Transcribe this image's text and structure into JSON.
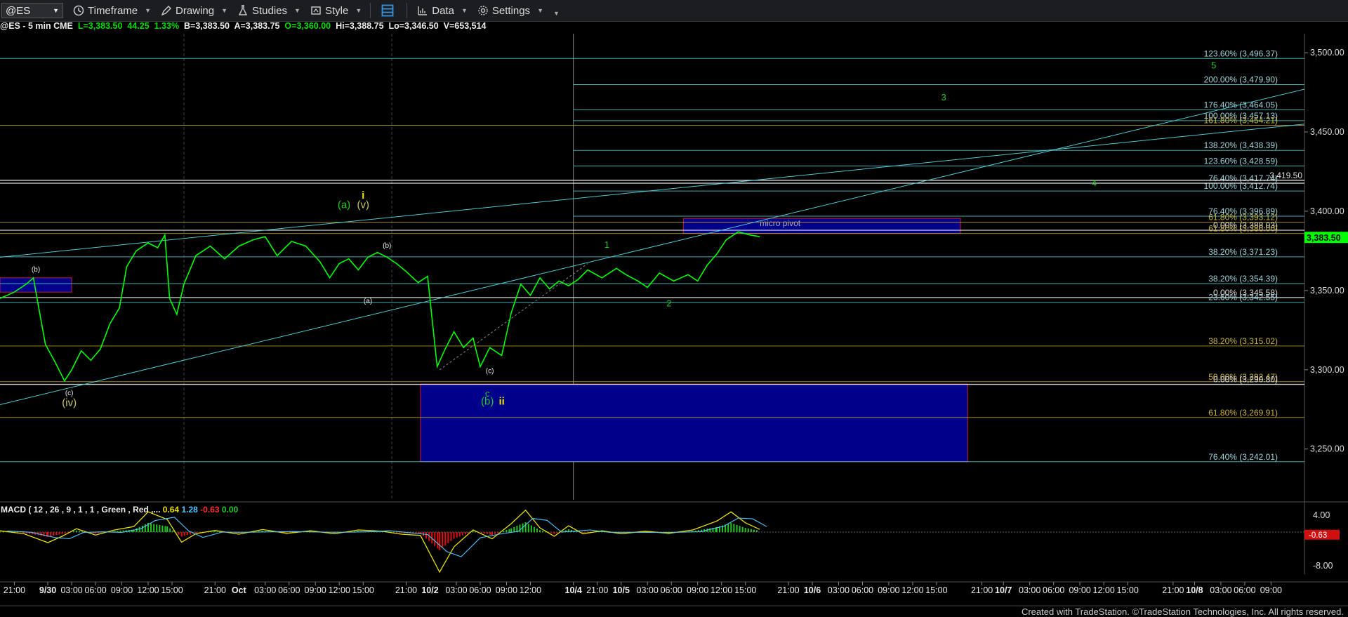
{
  "toolbar": {
    "symbol": "@ES",
    "items": [
      {
        "label": "Timeframe",
        "icon": "clock-icon"
      },
      {
        "label": "Drawing",
        "icon": "pencil-icon"
      },
      {
        "label": "Studies",
        "icon": "flask-icon"
      },
      {
        "label": "Style",
        "icon": "style-icon"
      },
      {
        "label": "",
        "icon": "layout-icon"
      },
      {
        "label": "Data",
        "icon": "data-icon"
      },
      {
        "label": "Settings",
        "icon": "gear-icon"
      }
    ]
  },
  "status": {
    "prefix": "@ES - 5 min  CME",
    "L": "L=3,383.50",
    "chg": "44.25",
    "pct": "1.33%",
    "B": "B=3,383.50",
    "A": "A=3,383.75",
    "O": "O=3,360.00",
    "Hi": "Hi=3,388.75",
    "Lo": "Lo=3,346.50",
    "V": "V=653,514"
  },
  "footer": "Created with TradeStation. ©TradeStation Technologies, Inc. All rights reserved.",
  "colors": {
    "price": "#00ff00",
    "cyan": "#4fc8d0",
    "gold": "#b39b2a",
    "box": "#00008b",
    "boxBorder": "#c81e3c",
    "label": "#c8c864"
  },
  "chart_data": [
    {
      "type": "line",
      "title": "@ES - 5 min",
      "price_axis": {
        "ylim": [
          3218,
          3512
        ],
        "ticks": [
          3250,
          3300,
          3350,
          3400,
          3450,
          3500
        ],
        "tick_labels": [
          "3,250.00",
          "3,300.00",
          "3,350.00",
          "3,400.00",
          "3,450.00",
          "3,500.00"
        ]
      },
      "current_price": {
        "value": 3383.5,
        "label": "3,383.50"
      },
      "time_axis_labels": [
        {
          "t": 0.3,
          "label": "21:00"
        },
        {
          "t": 1.0,
          "label": "9/30"
        },
        {
          "t": 1.5,
          "label": "03:00"
        },
        {
          "t": 2.0,
          "label": "06:00"
        },
        {
          "t": 2.55,
          "label": "09:00"
        },
        {
          "t": 3.1,
          "label": "12:00"
        },
        {
          "t": 3.6,
          "label": "15:00"
        },
        {
          "t": 4.5,
          "label": "21:00"
        },
        {
          "t": 5.0,
          "label": "Oct"
        },
        {
          "t": 5.55,
          "label": "03:00"
        },
        {
          "t": 6.05,
          "label": "06:00"
        },
        {
          "t": 6.6,
          "label": "09:00"
        },
        {
          "t": 7.1,
          "label": "12:00"
        },
        {
          "t": 7.6,
          "label": "15:00"
        },
        {
          "t": 8.5,
          "label": "21:00"
        },
        {
          "t": 9.0,
          "label": "10/2"
        },
        {
          "t": 9.55,
          "label": "03:00"
        },
        {
          "t": 10.05,
          "label": "06:00"
        },
        {
          "t": 10.6,
          "label": "09:00"
        },
        {
          "t": 11.1,
          "label": "12:00"
        },
        {
          "t": 12.0,
          "label": "10/4"
        },
        {
          "t": 12.5,
          "label": "21:00"
        },
        {
          "t": 13.0,
          "label": "10/5"
        },
        {
          "t": 13.55,
          "label": "03:00"
        },
        {
          "t": 14.05,
          "label": "06:00"
        },
        {
          "t": 14.6,
          "label": "09:00"
        },
        {
          "t": 15.1,
          "label": "12:00"
        },
        {
          "t": 15.6,
          "label": "15:00"
        },
        {
          "t": 16.5,
          "label": "21:00"
        },
        {
          "t": 17.0,
          "label": "10/6"
        },
        {
          "t": 17.55,
          "label": "03:00"
        },
        {
          "t": 18.05,
          "label": "06:00"
        },
        {
          "t": 18.6,
          "label": "09:00"
        },
        {
          "t": 19.1,
          "label": "12:00"
        },
        {
          "t": 19.6,
          "label": "15:00"
        },
        {
          "t": 20.55,
          "label": "21:00"
        },
        {
          "t": 21.0,
          "label": "10/7"
        },
        {
          "t": 21.55,
          "label": "03:00"
        },
        {
          "t": 22.05,
          "label": "06:00"
        },
        {
          "t": 22.6,
          "label": "09:00"
        },
        {
          "t": 23.1,
          "label": "12:00"
        },
        {
          "t": 23.6,
          "label": "15:00"
        },
        {
          "t": 24.55,
          "label": "21:00"
        },
        {
          "t": 25.0,
          "label": "10/8"
        },
        {
          "t": 25.55,
          "label": "03:00"
        },
        {
          "t": 26.05,
          "label": "06:00"
        },
        {
          "t": 26.6,
          "label": "09:00"
        }
      ],
      "x_range": [
        0,
        27.3
      ],
      "series": [
        {
          "name": "price",
          "points": [
            [
              0,
              3345
            ],
            [
              0.3,
              3349
            ],
            [
              0.55,
              3354
            ],
            [
              0.7,
              3358
            ],
            [
              0.8,
              3341
            ],
            [
              0.95,
              3316
            ],
            [
              1.15,
              3305
            ],
            [
              1.35,
              3293
            ],
            [
              1.5,
              3300
            ],
            [
              1.7,
              3312
            ],
            [
              1.9,
              3306
            ],
            [
              2.1,
              3313
            ],
            [
              2.3,
              3329
            ],
            [
              2.5,
              3339
            ],
            [
              2.65,
              3365
            ],
            [
              2.85,
              3375
            ],
            [
              3.1,
              3380
            ],
            [
              3.3,
              3377
            ],
            [
              3.45,
              3385
            ],
            [
              3.55,
              3345
            ],
            [
              3.7,
              3335
            ],
            [
              3.85,
              3354
            ],
            [
              4.1,
              3372
            ],
            [
              4.4,
              3378
            ],
            [
              4.7,
              3370
            ],
            [
              5.0,
              3378
            ],
            [
              5.3,
              3382
            ],
            [
              5.55,
              3384
            ],
            [
              5.8,
              3372
            ],
            [
              6.1,
              3381
            ],
            [
              6.4,
              3378
            ],
            [
              6.7,
              3368
            ],
            [
              6.9,
              3358
            ],
            [
              7.1,
              3367
            ],
            [
              7.3,
              3370
            ],
            [
              7.5,
              3363
            ],
            [
              7.7,
              3371
            ],
            [
              7.9,
              3374
            ],
            [
              8.1,
              3371
            ],
            [
              8.3,
              3367
            ],
            [
              8.5,
              3362
            ],
            [
              8.75,
              3355
            ],
            [
              8.95,
              3359
            ],
            [
              9.05,
              3330
            ],
            [
              9.15,
              3302
            ],
            [
              9.3,
              3312
            ],
            [
              9.5,
              3324
            ],
            [
              9.7,
              3314
            ],
            [
              9.9,
              3320
            ],
            [
              10.05,
              3302
            ],
            [
              10.25,
              3314
            ],
            [
              10.5,
              3309
            ],
            [
              10.7,
              3336
            ],
            [
              10.9,
              3354
            ],
            [
              11.1,
              3347
            ],
            [
              11.3,
              3358
            ],
            [
              11.5,
              3351
            ],
            [
              11.7,
              3356
            ],
            [
              11.9,
              3353
            ],
            [
              12.1,
              3357
            ],
            [
              12.3,
              3363
            ],
            [
              12.6,
              3358
            ],
            [
              12.9,
              3364
            ],
            [
              13.1,
              3360
            ],
            [
              13.35,
              3356
            ],
            [
              13.55,
              3352
            ],
            [
              13.8,
              3361
            ],
            [
              14.1,
              3356
            ],
            [
              14.4,
              3360
            ],
            [
              14.6,
              3356
            ],
            [
              14.8,
              3366
            ],
            [
              15.0,
              3373
            ],
            [
              15.2,
              3382
            ],
            [
              15.45,
              3387
            ],
            [
              15.7,
              3385
            ],
            [
              15.9,
              3384
            ]
          ]
        },
        {
          "name": "macd",
          "points": [
            [
              0,
              0.3
            ],
            [
              0.5,
              -0.4
            ],
            [
              1.0,
              -2.5
            ],
            [
              1.3,
              -1.0
            ],
            [
              1.6,
              0.8
            ],
            [
              2.0,
              -0.7
            ],
            [
              2.4,
              0.5
            ],
            [
              2.8,
              1.3
            ],
            [
              3.1,
              4.8
            ],
            [
              3.5,
              3.0
            ],
            [
              3.8,
              -2.4
            ],
            [
              4.1,
              -0.4
            ],
            [
              4.5,
              0.4
            ],
            [
              5.0,
              -0.5
            ],
            [
              5.5,
              0.6
            ],
            [
              6.0,
              -0.3
            ],
            [
              6.5,
              0.3
            ],
            [
              7.0,
              -0.4
            ],
            [
              7.5,
              0.5
            ],
            [
              8.0,
              0.2
            ],
            [
              8.4,
              -0.5
            ],
            [
              8.8,
              -0.8
            ],
            [
              9.2,
              -9.5
            ],
            [
              9.5,
              -3.5
            ],
            [
              9.9,
              0.5
            ],
            [
              10.3,
              -1.6
            ],
            [
              10.7,
              2.0
            ],
            [
              11.0,
              5.2
            ],
            [
              11.3,
              1.0
            ],
            [
              11.6,
              -1.0
            ],
            [
              11.9,
              1.5
            ],
            [
              12.2,
              -0.4
            ],
            [
              12.6,
              0.3
            ],
            [
              13.0,
              -0.4
            ],
            [
              13.5,
              0.2
            ],
            [
              14.0,
              -0.3
            ],
            [
              14.5,
              0.5
            ],
            [
              15.0,
              2.6
            ],
            [
              15.3,
              4.8
            ],
            [
              15.6,
              2.2
            ],
            [
              15.9,
              0.64
            ]
          ]
        }
      ],
      "fib_levels": [
        {
          "text": "123.60% (3,496.37)",
          "value": 3496.37,
          "color": "cyan"
        },
        {
          "text": "200.00% (3,479.90)",
          "value": 3479.9,
          "color": "cyan"
        },
        {
          "text": "176.40% (3,464.05)",
          "value": 3464.05,
          "color": "cyan"
        },
        {
          "text": "100.00% (3,457.13)",
          "value": 3457.13,
          "color": "cyan"
        },
        {
          "text": "161.80% (3,454.21)",
          "value": 3454.21,
          "color": "gold"
        },
        {
          "text": "138.20% (3,438.39)",
          "value": 3438.39,
          "color": "cyan"
        },
        {
          "text": "123.60% (3,428.59)",
          "value": 3428.59,
          "color": "cyan"
        },
        {
          "text": "76.40% (3,417.74)",
          "value": 3417.74,
          "color": "cyan"
        },
        {
          "text": "3,419.50",
          "value": 3419.5,
          "color": "white"
        },
        {
          "text": "100.00% (3,412.74)",
          "value": 3412.74,
          "color": "cyan"
        },
        {
          "text": "76.40% (3,396.89)",
          "value": 3396.89,
          "color": "cyan"
        },
        {
          "text": "61.80% (3,393.12)",
          "value": 3393.12,
          "color": "gold"
        },
        {
          "text": "0.00% (3,388.03)",
          "value": 3388.03,
          "color": "white"
        },
        {
          "text": "61.80% (3,386.00)",
          "value": 3386.0,
          "color": "gold"
        },
        {
          "text": "38.20% (3,371.23)",
          "value": 3371.23,
          "color": "cyan"
        },
        {
          "text": "38.20% (3,354.39)",
          "value": 3354.39,
          "color": "cyan"
        },
        {
          "text": "0.00% (3,345.58)",
          "value": 3345.58,
          "color": "white"
        },
        {
          "text": "23.60% (3,342.55)",
          "value": 3342.55,
          "color": "cyan"
        },
        {
          "text": "38.20% (3,315.02)",
          "value": 3315.02,
          "color": "gold"
        },
        {
          "text": "50.00% (3,292.47)",
          "value": 3292.47,
          "color": "gold"
        },
        {
          "text": "0.00% (3,290.80)",
          "value": 3290.8,
          "color": "white"
        },
        {
          "text": "61.80% (3,269.91)",
          "value": 3269.91,
          "color": "gold"
        },
        {
          "text": "76.40% (3,242.01)",
          "value": 3242.01,
          "color": "cyan"
        }
      ],
      "wave_labels": [
        {
          "text": "(b)",
          "t": 0.75,
          "value": 3362,
          "color": "white"
        },
        {
          "text": "(c)",
          "t": 1.45,
          "value": 3284,
          "color": "white"
        },
        {
          "text": "(iv)",
          "t": 1.45,
          "value": 3277,
          "color": "label"
        },
        {
          "text": "(a)",
          "t": 7.2,
          "value": 3402,
          "color": "green"
        },
        {
          "text": "(v)",
          "t": 7.6,
          "value": 3402,
          "color": "label"
        },
        {
          "text": "i",
          "t": 7.6,
          "value": 3408,
          "color": "yellow"
        },
        {
          "text": "(b)",
          "t": 8.1,
          "value": 3377,
          "color": "white"
        },
        {
          "text": "(a)",
          "t": 7.7,
          "value": 3342,
          "color": "white"
        },
        {
          "text": "(c)",
          "t": 10.25,
          "value": 3298,
          "color": "white"
        },
        {
          "text": "c",
          "t": 10.2,
          "value": 3283,
          "color": "green"
        },
        {
          "text": "(b)",
          "t": 10.2,
          "value": 3278,
          "color": "green"
        },
        {
          "text": "ii",
          "t": 10.5,
          "value": 3278,
          "color": "yellow"
        },
        {
          "text": "1",
          "t": 12.7,
          "value": 3377,
          "color": "green"
        },
        {
          "text": "2",
          "t": 14.0,
          "value": 3340,
          "color": "green"
        },
        {
          "text": "3",
          "t": 19.75,
          "value": 3470,
          "color": "green"
        },
        {
          "text": "4",
          "t": 22.9,
          "value": 3416,
          "color": "green"
        },
        {
          "text": "5",
          "t": 25.4,
          "value": 3490,
          "color": "green"
        }
      ],
      "annotation": "micro pivot",
      "macd": {
        "label": "MACD ( 12 , 26 , 9 , 1 , 1 , Green , Red ,...",
        "v1": "0.64",
        "v2": "1.28",
        "v3": "-0.63",
        "v4": "0.00",
        "ylim": [
          -10,
          6
        ],
        "ticks": [
          4,
          -8
        ],
        "tick_labels": [
          "4.00",
          "-8.00"
        ],
        "current_label": "-0.63"
      }
    }
  ]
}
